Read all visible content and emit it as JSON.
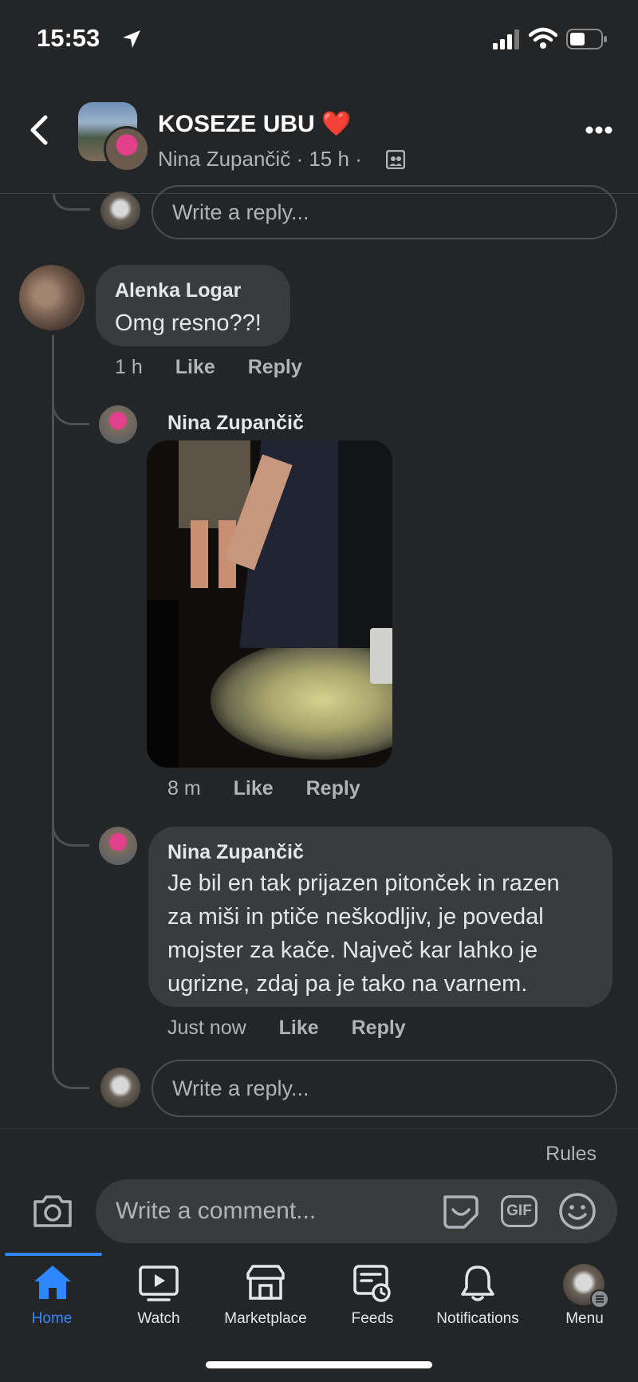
{
  "status_bar": {
    "time": "15:53"
  },
  "header": {
    "group_name": "KOSEZE UBU",
    "heart_emoji": "❤️",
    "author": "Nina Zupančič",
    "time": "15 h",
    "separator": "·"
  },
  "comments": {
    "top_reply_placeholder": "Write a reply...",
    "alenka": {
      "name": "Alenka Logar",
      "text": "Omg resno??!",
      "time": "1 h",
      "like": "Like",
      "reply": "Reply"
    },
    "nina_photo": {
      "name": "Nina Zupančič",
      "time": "8 m",
      "like": "Like",
      "reply": "Reply"
    },
    "nina_text": {
      "name": "Nina Zupančič",
      "line1": "Je bil en tak prijazen pitonček in razen",
      "line2": "za miši in ptiče neškodljiv, je povedal",
      "line3": "mojster za kače. Največ kar lahko je",
      "line4": "ugrizne, zdaj pa je tako na varnem.",
      "time": "Just now",
      "like": "Like",
      "reply": "Reply"
    },
    "bottom_reply_placeholder": "Write a reply..."
  },
  "composer": {
    "rules": "Rules",
    "placeholder": "Write a comment...",
    "gif": "GIF"
  },
  "tabbar": {
    "home": "Home",
    "watch": "Watch",
    "marketplace": "Marketplace",
    "feeds": "Feeds",
    "notifications": "Notifications",
    "menu": "Menu",
    "active_color": "#2d88ff"
  }
}
